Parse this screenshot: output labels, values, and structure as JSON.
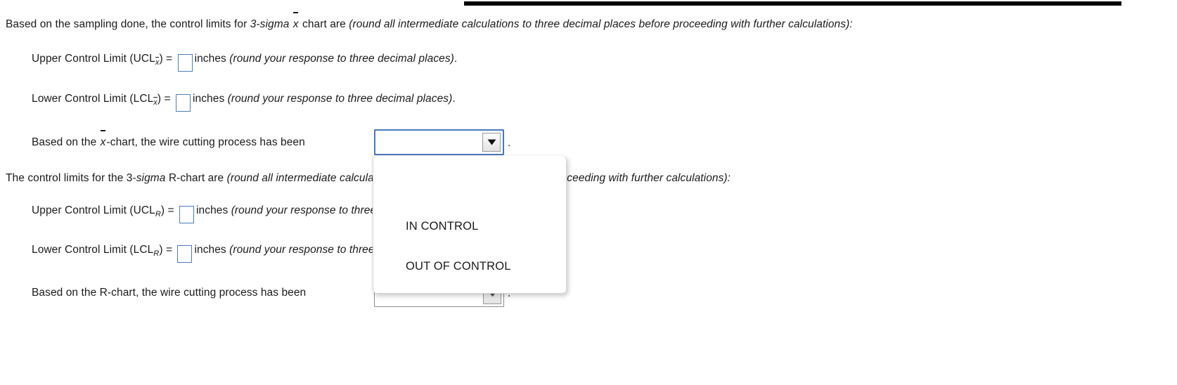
{
  "page": {
    "top_rule_present": true,
    "accent_border_color": "#4878c0",
    "input_border_color": "#4a7ebb"
  },
  "intro": {
    "prefix": "Based on the sampling done, the control limits for ",
    "sigma_label": "3-sigma",
    "xbar_symbol": "x",
    "mid": " chart are ",
    "instruction_italic": "(round all intermediate calculations to three decimal places before proceeding with further calculations):"
  },
  "xbar_section": {
    "ucl": {
      "label_main": "Upper Control Limit (UCL",
      "label_sub": "x",
      "label_close": ") = ",
      "value": "",
      "units": "inches ",
      "note_italic": "(round your response to three decimal places)",
      "note_period": "."
    },
    "lcl": {
      "label_main": "Lower Control Limit (LCL",
      "label_sub": "x",
      "label_close": ") = ",
      "value": "",
      "units": "inches ",
      "note_italic": "(round your response to three decimal places)",
      "note_period": "."
    },
    "conclusion": {
      "prefix_a": "Based on the ",
      "xbar_symbol": "x",
      "prefix_b": "-chart, the wire cutting process has been ",
      "selected_value": "",
      "period": "."
    }
  },
  "rchart_intro": {
    "prefix": "The control limits for the 3-",
    "sigma_italic": "sigma",
    "mid": " R-chart are ",
    "instruction_italic": "(round all intermediate calculations to three decimal places before proceeding with further calculations):"
  },
  "rchart_section": {
    "ucl": {
      "label_main": "Upper Control Limit (UCL",
      "label_sub": "R",
      "label_close": ") = ",
      "value": "",
      "units": "inches ",
      "note_italic": "(round your response to three decimal places)",
      "note_period": "."
    },
    "lcl": {
      "label_main": "Lower Control Limit (LCL",
      "label_sub": "R",
      "label_close": ") = ",
      "value": "",
      "units": "inches ",
      "note_italic": "(round your response to three decimal places)",
      "note_period": "."
    },
    "conclusion": {
      "prefix": "Based on the R-chart, the wire cutting process has been ",
      "selected_value": "",
      "period": "."
    }
  },
  "dropdown": {
    "open": true,
    "options": [
      "IN CONTROL",
      "OUT OF CONTROL"
    ]
  },
  "icons": {
    "dropdown_arrow": "triangle-down-icon"
  }
}
